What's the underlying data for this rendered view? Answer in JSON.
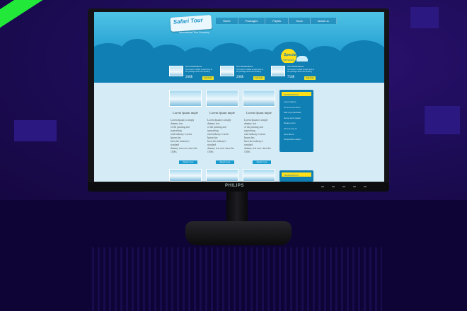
{
  "monitor": {
    "brand": "PHILIPS"
  },
  "site": {
    "logo": "Safari Tour",
    "tagline": "International Tour Company",
    "nav": [
      "Home",
      "Packages",
      "Flights",
      "Tours",
      "About us"
    ],
    "special": {
      "line1": "Special",
      "line2": "Services"
    },
    "promos": [
      {
        "title": "Tour Destinations",
        "desc": "Text more is visible to learn text at the package about and booking",
        "price": "200$",
        "button": "read more"
      },
      {
        "title": "Tour Destinations",
        "desc": "Text more is visible to learn text at the package about and booking",
        "price": "200$",
        "button": "read more"
      },
      {
        "title": "Tour Destinations",
        "desc": "Text more is visible to learn text at the package about and booking",
        "price": "750$",
        "button": "read more"
      }
    ],
    "cards": [
      {
        "title": "Lorem Ipsum imple",
        "body": "Lorem Ipsum is simply\ndummy text\nof the printing and\ntypesetting\nread industry. Lorem\nIpsum has\nbeen the industry's\nstandard\ndummy text ever since the\n1500s",
        "button": "Read more"
      },
      {
        "title": "Lorem Ipsum imple",
        "body": "Lorem Ipsum is simply\ndummy text\nof the printing and\ntypesetting\nread industry. Lorem\nIpsum has\nbeen the industry's\nstandard\ndummy text ever since the\n1500s",
        "button": "Read more"
      },
      {
        "title": "Lorem Ipsum imple",
        "body": "Lorem Ipsum is simply\ndummy text\nof the printing and\ntypesetting\nread industry. Lorem\nIpsum has\nbeen the industry's\nstandard\ndummy text ever since the\n1500s",
        "button": "Read more"
      }
    ],
    "sidebar": {
      "heading": "INFORMATION",
      "items": [
        "Lorem ipsum",
        "Ut enim ad minim",
        "Sed ut perspiciatis",
        "Nemo enim ipsam",
        "Neque porro",
        "At vero eos et",
        "Nam libero",
        "Temporibus autem"
      ]
    },
    "sidebar2": {
      "heading": "INFORMATION"
    }
  },
  "colors": {
    "background": "#1c0c55",
    "stripe": "#22e83a",
    "site_blue": "#0f7fb4",
    "accent_yellow": "#ffde1a"
  }
}
